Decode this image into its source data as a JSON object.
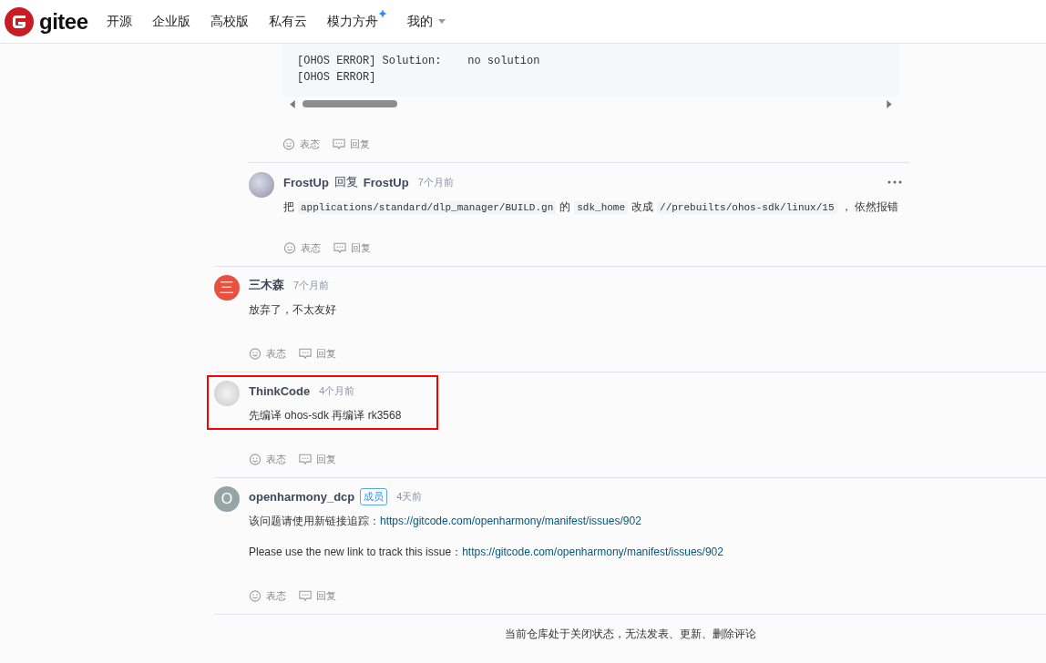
{
  "nav": {
    "logo": "gitee",
    "items": [
      {
        "label": "开源",
        "kind": "plain"
      },
      {
        "label": "企业版",
        "kind": "plain"
      },
      {
        "label": "高校版",
        "kind": "plain"
      },
      {
        "label": "私有云",
        "kind": "plain"
      },
      {
        "label": "模力方舟",
        "kind": "sparkle"
      },
      {
        "label": "我的",
        "kind": "dropdown"
      }
    ]
  },
  "code_block": {
    "lines": [
      "[OHOS ERROR] Solution:    no solution",
      "[OHOS ERROR]"
    ]
  },
  "code_actions": {
    "react": "表态",
    "reply": "回复"
  },
  "nested_reply": {
    "author": "FrostUp",
    "reply_word": "回复",
    "target": "FrostUp",
    "time": "7个月前",
    "body": [
      {
        "kind": "text",
        "text": "把"
      },
      {
        "kind": "code",
        "text": "applications/standard/dlp_manager/BUILD.gn"
      },
      {
        "kind": "text",
        "text": "的"
      },
      {
        "kind": "code",
        "text": "sdk_home"
      },
      {
        "kind": "text",
        "text": "改成"
      },
      {
        "kind": "code",
        "text": "//prebuilts/ohos-sdk/linux/15"
      },
      {
        "kind": "text",
        "text": "， 依然报错"
      }
    ],
    "react": "表态",
    "reply": "回复"
  },
  "comments": [
    {
      "author": "三木森",
      "avatar": {
        "kind": "letter",
        "text": "三",
        "color": "#e8513f"
      },
      "time": "7个月前",
      "highlighted": false,
      "paragraphs": [
        [
          {
            "kind": "text",
            "text": "放弃了，不太友好"
          }
        ]
      ],
      "react": "表态",
      "reply": "回复"
    },
    {
      "author": "ThinkCode",
      "avatar": {
        "kind": "image"
      },
      "time": "4个月前",
      "highlighted": true,
      "paragraphs": [
        [
          {
            "kind": "text",
            "text": "先编译 ohos-sdk 再编译 rk3568"
          }
        ]
      ],
      "react": "表态",
      "reply": "回复"
    },
    {
      "author": "openharmony_dcp",
      "badge": "成员",
      "avatar": {
        "kind": "letter",
        "text": "O",
        "color": "#95a5a6"
      },
      "time": "4天前",
      "highlighted": false,
      "paragraphs": [
        [
          {
            "kind": "text",
            "text": "该问题请使用新链接追踪："
          },
          {
            "kind": "link",
            "text": "https://gitcode.com/openharmony/manifest/issues/902"
          }
        ],
        [
          {
            "kind": "text",
            "text": "Please use the new link to track this issue："
          },
          {
            "kind": "link",
            "text": "https://gitcode.com/openharmony/manifest/issues/902"
          }
        ]
      ],
      "react": "表态",
      "reply": "回复"
    }
  ],
  "notice": "当前仓库处于关闭状态，无法发表、更新、删除评论"
}
